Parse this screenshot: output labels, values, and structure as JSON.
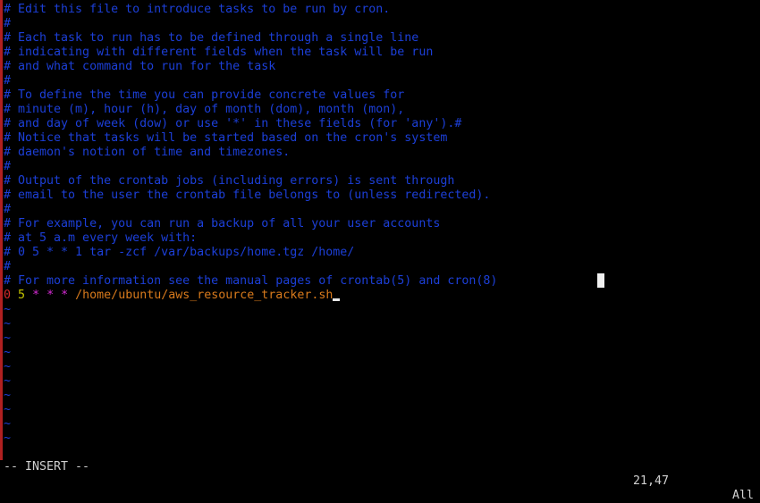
{
  "editor": {
    "comments": [
      "# Edit this file to introduce tasks to be run by cron.",
      "#",
      "# Each task to run has to be defined through a single line",
      "# indicating with different fields when the task will be run",
      "# and what command to run for the task",
      "#",
      "# To define the time you can provide concrete values for",
      "# minute (m), hour (h), day of month (dom), month (mon),",
      "# and day of week (dow) or use '*' in these fields (for 'any').#",
      "# Notice that tasks will be started based on the cron's system",
      "# daemon's notion of time and timezones.",
      "#",
      "# Output of the crontab jobs (including errors) is sent through",
      "# email to the user the crontab file belongs to (unless redirected).",
      "#",
      "# For example, you can run a backup of all your user accounts",
      "# at 5 a.m every week with:",
      "# 0 5 * * 1 tar -zcf /var/backups/home.tgz /home/",
      "#",
      "# For more information see the manual pages of crontab(5) and cron(8)"
    ],
    "cron_entry": {
      "minute": "0",
      "hour": "5",
      "day_of_month": "*",
      "month": "*",
      "day_of_week": "*",
      "command": "/home/ubuntu/aws_resource_tracker.sh"
    },
    "empty_lines": [
      "~",
      "~",
      "~",
      "~",
      "~",
      "~",
      "~",
      "~",
      "~",
      "~"
    ]
  },
  "status_bar": {
    "mode": "-- INSERT --",
    "position": "21,47",
    "scroll": "All"
  },
  "colors": {
    "comment": "#1c3fd8",
    "minute": "#d42a2a",
    "hour": "#c4c400",
    "wildcard": "#d72bd7",
    "command": "#d87a1c",
    "background": "#000000"
  }
}
